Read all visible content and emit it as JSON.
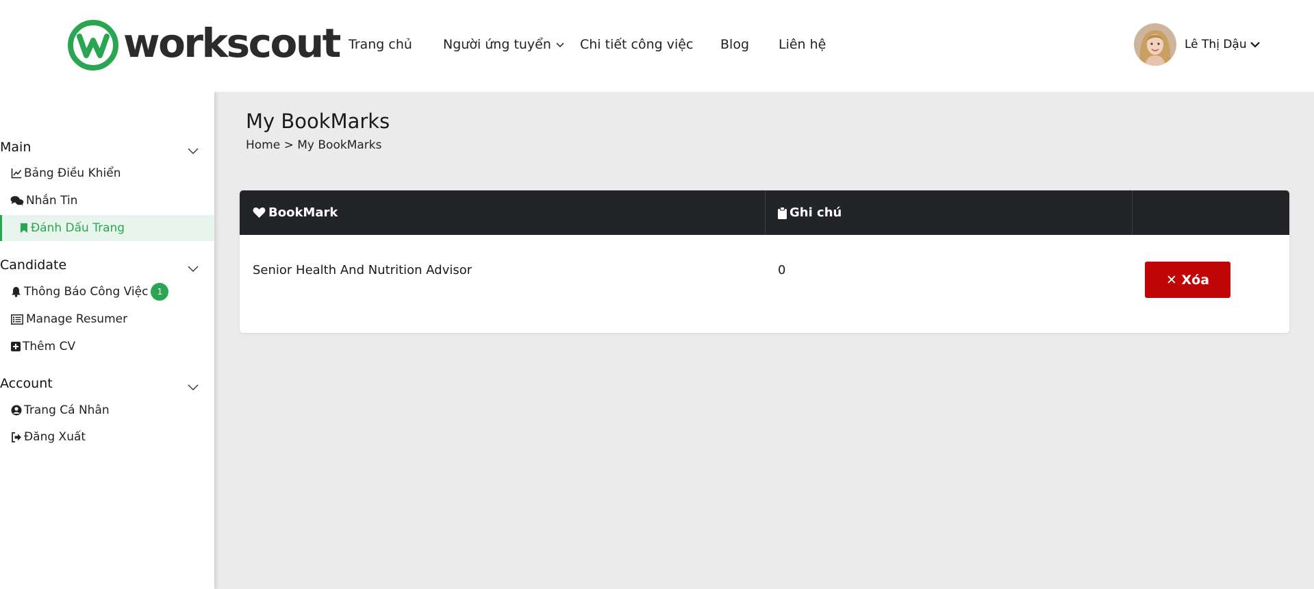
{
  "header": {
    "logo_text": "workscout",
    "nav": [
      {
        "label": "Trang chủ"
      },
      {
        "label": "Người ứng tuyển"
      },
      {
        "label": "Chi tiết công việc"
      },
      {
        "label": "Blog"
      },
      {
        "label": "Liên hệ"
      }
    ],
    "user_name": "Lê Thị Dậu"
  },
  "sidebar": {
    "sections": [
      {
        "title": "Main",
        "items": [
          {
            "label": "Bảng Điều Khiển",
            "icon": "chart-line-icon"
          },
          {
            "label": "Nhắn Tin",
            "icon": "comments-icon"
          },
          {
            "label": "Đánh Dấu Trang",
            "icon": "bookmark-icon",
            "active": true
          }
        ]
      },
      {
        "title": "Candidate",
        "items": [
          {
            "label": "Thông Báo Công Việc",
            "icon": "bell-icon",
            "badge": "1"
          },
          {
            "label": "Manage Resumer",
            "icon": "list-icon"
          },
          {
            "label": "Thêm CV",
            "icon": "plus-square-icon"
          }
        ]
      },
      {
        "title": "Account",
        "items": [
          {
            "label": "Trang Cá Nhân",
            "icon": "user-circle-icon"
          },
          {
            "label": "Đăng Xuất",
            "icon": "sign-out-icon"
          }
        ]
      }
    ]
  },
  "main": {
    "title": "My BookMarks",
    "breadcrumb": {
      "home": "Home",
      "separator": ">",
      "current": "My BookMarks"
    },
    "table": {
      "headers": [
        {
          "label": "BookMark",
          "icon": "heart-icon"
        },
        {
          "label": "Ghi chú",
          "icon": "clipboard-icon"
        },
        {
          "label": ""
        }
      ],
      "rows": [
        {
          "bookmark": "Senior Health And Nutrition Advisor",
          "note": "0",
          "action_label": "✕ Xóa"
        }
      ]
    }
  },
  "colors": {
    "accent": "#2aa653",
    "danger": "#c00606",
    "table_header": "#222428",
    "main_bg": "#ebebeb"
  }
}
